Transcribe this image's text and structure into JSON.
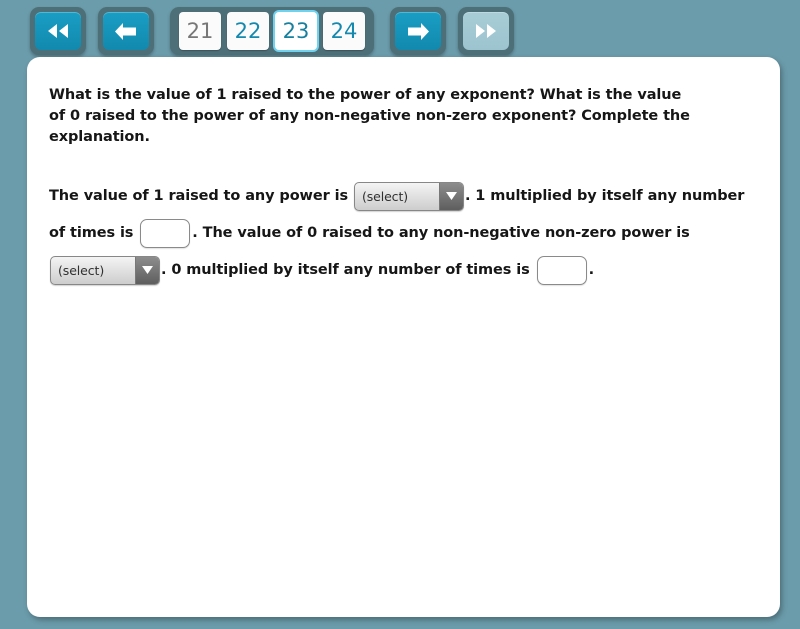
{
  "theme": {
    "background": "#6b9cab",
    "panel_background": "#ffffff",
    "toolbar_group_background": "#4d6f78",
    "accent": "#1489ad",
    "accent_disabled": "#a8cdd6",
    "current_page_outline": "#6fd2ee",
    "visited_page_text": "#777777"
  },
  "toolbar": {
    "first_button": {
      "icon": "double-left-arrow-icon",
      "state": "enabled"
    },
    "previous_button": {
      "icon": "left-arrow-icon",
      "state": "enabled"
    },
    "pages": [
      {
        "label": "21",
        "state": "visited"
      },
      {
        "label": "22",
        "state": "link"
      },
      {
        "label": "23",
        "state": "current"
      },
      {
        "label": "24",
        "state": "link"
      }
    ],
    "next_button": {
      "icon": "right-arrow-icon",
      "state": "enabled"
    },
    "last_button": {
      "icon": "double-right-arrow-icon",
      "state": "disabled"
    }
  },
  "content": {
    "question": "What is the value of 1 raised to the power of any exponent? What is the value of 0 raised to the power of any non-negative non-zero exponent? Complete the explanation.",
    "answer": {
      "part1": "The value of 1 raised to any power is",
      "select1": {
        "value": "(select)"
      },
      "part2": ". 1 multiplied by itself any number",
      "part3": "of times is",
      "input1": {
        "value": "",
        "placeholder": ""
      },
      "part4": ". The value of 0 raised to any non-negative non-zero power is",
      "select2": {
        "value": "(select)"
      },
      "part5": ". 0 multiplied by itself any number of times is",
      "input2": {
        "value": "",
        "placeholder": ""
      },
      "part6": "."
    }
  }
}
